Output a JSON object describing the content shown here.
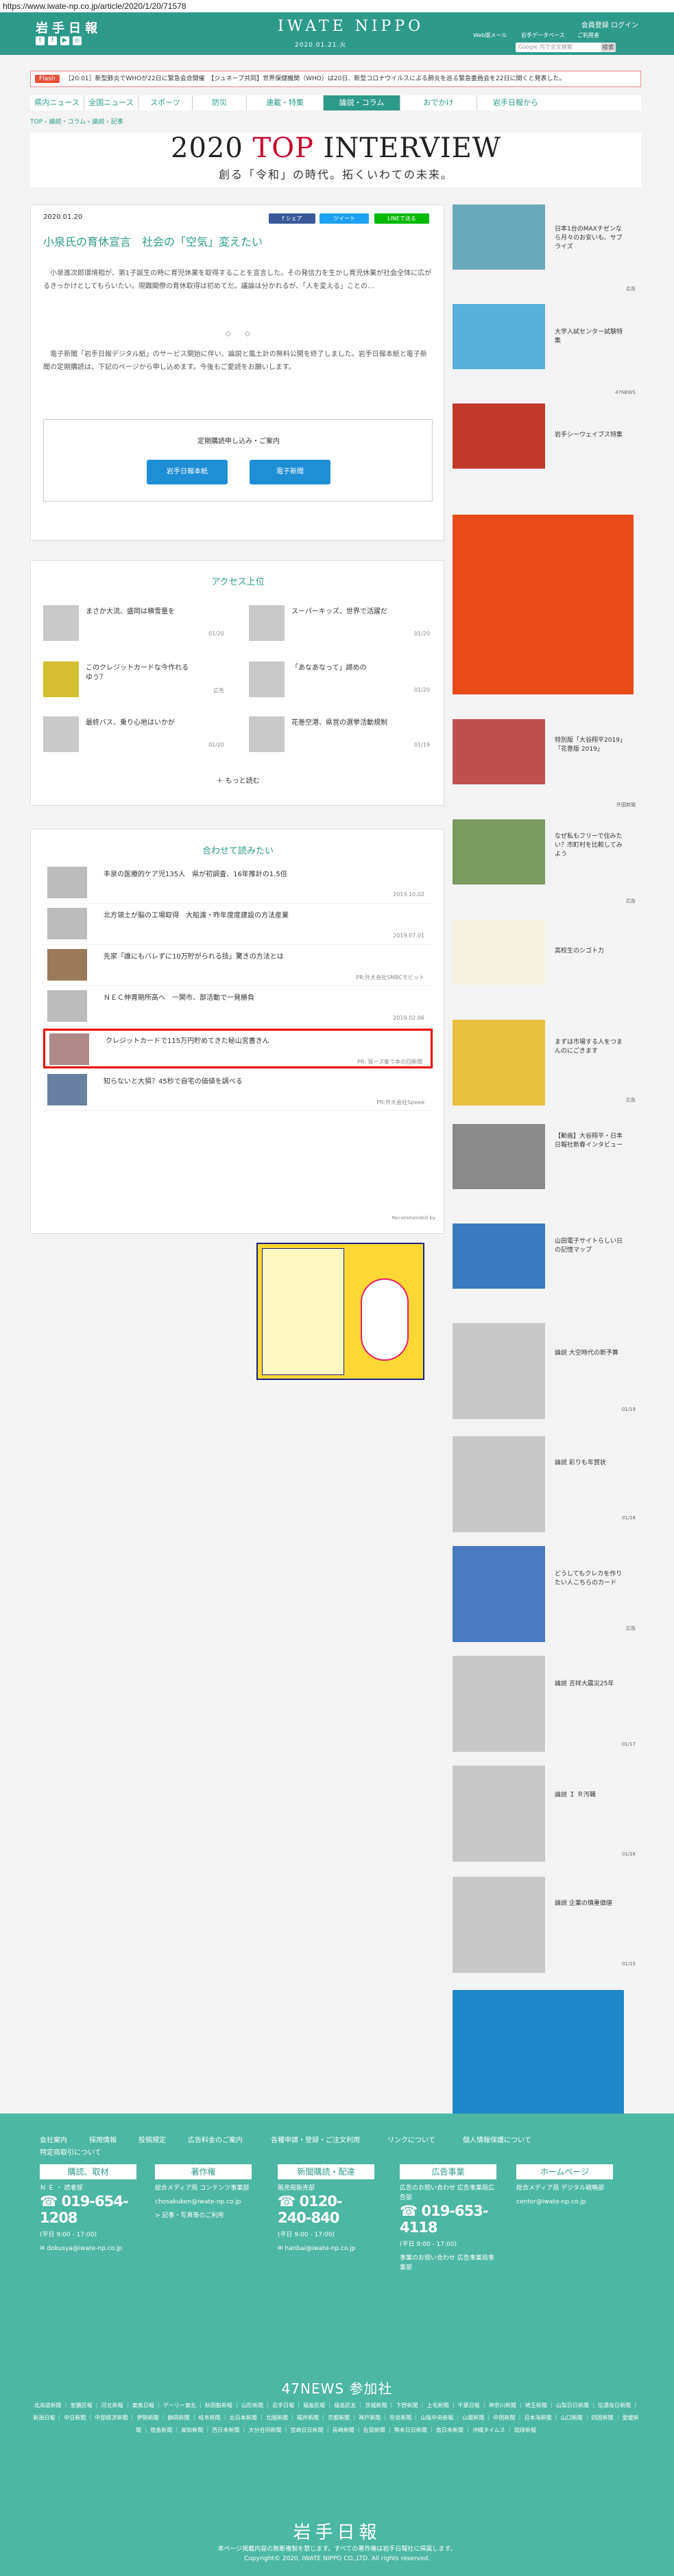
{
  "url": "https://www.iwate-np.co.jp/article/2020/1/20/71578",
  "header": {
    "logo": "岩手日報",
    "brand": "IWATE NIPPO",
    "date": "2020.01.21.火",
    "member": "会員登録  ログイン",
    "links": [
      "Web版メール",
      "岩手データベース",
      "ご利用者"
    ],
    "search_placeholder": "Google 内で全文検索",
    "search_btn": "検索"
  },
  "flash": {
    "tag": "Flash",
    "text": "［20:01］新型肺炎でWHOが22日に緊急会合開催　【ジュネーブ共同】世界保健機関（WHO）は20日、新型コロナウイルスによる肺炎を巡る緊急委員会を22日に開くと発表した。"
  },
  "nav": [
    "県内ニュース",
    "全国ニュース",
    "スポーツ",
    "防災",
    "連載・特集",
    "論説・コラム",
    "おでかけ",
    "岩手日報から"
  ],
  "nav_active": 5,
  "breadcrumb": "TOP › 論説・コラム › 論説 › 記事",
  "banner": {
    "title_a": "2020 ",
    "title_b": "TOP",
    "title_c": " INTERVIEW",
    "subtitle": "創る「令和」の時代。拓くいわての未来。"
  },
  "article": {
    "date": "2020.01.20",
    "share": [
      "f シェア",
      "ツイート",
      "LINEで送る"
    ],
    "title": "小泉氏の育休宣言　社会の「空気」変えたい",
    "body1": "　小泉進次郎環境相が、第1子誕生の時に育児休業を取得することを宣言した。その発信力を生かし育児休業が社会全体に広がるきっかけとしてもらいたい。現職閣僚の育休取得は初めてだ。議論は分かれるが、「人を変える」ことの…",
    "sep": "◇　　◇",
    "body2": "　電子新聞「岩手日報デジタル紙」のサービス開始に伴い、論説と風土計の無料公開を終了しました。岩手日報本紙と電子新聞の定期購読は、下記のページから申し込めます。今後もご愛読をお願いします。",
    "sub_title": "定期購読申し込み・ご案内",
    "btn_paper": "岩手日報本紙",
    "btn_digital": "電子新聞"
  },
  "ranking": {
    "title": "アクセス上位",
    "items": [
      {
        "t": "まさか大流、盛岡は積雪量を",
        "d": "01/20"
      },
      {
        "t": "スーパーキッズ、世界で活躍だ",
        "d": "01/20"
      },
      {
        "t": "このクレジットカードな今作れるゆう？",
        "d": "広告"
      },
      {
        "t": "「あなあなって」諦めの",
        "d": "01/20"
      },
      {
        "t": "最終バス、乗り心地はいかが",
        "d": "01/20"
      },
      {
        "t": "花巻空港、県営の選挙活動規制",
        "d": "01/19"
      }
    ],
    "more": "もっと読む"
  },
  "recommend": {
    "title": "合わせて読みたい",
    "items": [
      {
        "t": "丰泉の医療的ケア児135人　県が初調査、16年推計の1.5倍",
        "s": "2019.10.02"
      },
      {
        "t": "北方領土が脳の工場取得　大船渡・昨年度度建設の方法産業",
        "s": "2019.07.01"
      },
      {
        "t": "先家「誰にもバレずに10万貯がられる技」驚きの方法とは",
        "s": "PR:外大会社SMBCモビット"
      },
      {
        "t": "ＮＥＣ伸育期所高へ　一関市、部活動で一発勝負",
        "s": "2019.02.06"
      },
      {
        "t": "クレジットカードで115万円貯めてきた秘山宮書きん",
        "s": "PR: 買ーズ集う本の回新聞"
      },
      {
        "t": "知らないと大損？45秒で自宅の価値を調べる",
        "s": "PR:外大会社Speee"
      }
    ],
    "powered": "Recommended by"
  },
  "side": [
    {
      "t": "日本1台のMAXチゼンなら月々のお安いも、サブライズ",
      "d": "広告"
    },
    {
      "t": "大学入試センター試験特集",
      "d": "47NEWS"
    },
    {
      "t": "岩手シーウェイブス特集",
      "d": ""
    },
    {
      "t": "",
      "d": ""
    },
    {
      "t": "特別版「大谷翔平2019」「花巻版 2019」",
      "d": "外国新聞"
    },
    {
      "t": "なぜ私もフリーで住みたい？市町村を比較してみよう",
      "d": "広告"
    },
    {
      "t": "高校生のシゴト力",
      "d": ""
    },
    {
      "t": "まずは市場する人をつまんのにごきます",
      "d": "広告"
    },
    {
      "t": "【動画】大谷翔平・日本日報社新春インタビュー",
      "d": ""
    },
    {
      "t": "山田電子サイトらしい日の記憶マップ",
      "d": ""
    },
    {
      "t": "論説 大空時代の新予算",
      "d": "01/19"
    },
    {
      "t": "論説 彩りも年賀状",
      "d": "01/18"
    },
    {
      "t": "どうしてもクレカを作りたい人こちらのカード",
      "d": "広告"
    },
    {
      "t": "論説 吉祥大震災25年",
      "d": "01/17"
    },
    {
      "t": "論説 Ｉ Ｒ汚職",
      "d": "01/16"
    },
    {
      "t": "論説 企業の慎重価値",
      "d": "01/15"
    }
  ],
  "footer": {
    "links": [
      "会社案内",
      "採用情報",
      "投稿規定",
      "広告料金のご案内",
      "各種申請・登録・ご注文利用",
      "リンクについて",
      "個人情報保護について",
      "特定商取引について"
    ],
    "cols": [
      {
        "h": "購読、取材",
        "a": "Ｎ Ｅ ・ 読者部",
        "num": "019-654-1208",
        "hours": "(平日 9:00 - 17:00)",
        "mail": "dokusya@iwate-np.co.jp"
      },
      {
        "h": "著作権",
        "a": "総合メディア局 コンテンツ事業部",
        "num": "",
        "hours": "chosakuken@iwate-np.co.jp",
        "mail": "> 記事・写真等のご利用"
      },
      {
        "h": "新聞購読・配達",
        "a": "販売局販売部",
        "num": "0120-240-840",
        "hours": "(平日 9:00 - 17:00)",
        "mail": "hanbai@iwate-np.co.jp"
      },
      {
        "h": "広告事業",
        "a": "広告のお問い合わせ 広告事業局広告部",
        "num": "019-653-4118",
        "hours": "(平日 9:00 - 17:00)",
        "mail": "事業のお問い合わせ 広告事業局事業部"
      },
      {
        "h": "ホームページ",
        "a": "総合メディア局 デジタル戦略部",
        "num": "",
        "hours": "center@iwate-np.co.jp",
        "mail": ""
      }
    ],
    "n47": "47NEWS 参加社",
    "partners": "北海道新聞 ｜ 室蘭民報 ｜ 河北新報 ｜ 東奥日報 ｜ デーリー東北 ｜ 秋田魁新報 ｜ 山形新聞 ｜ 岩手日報 ｜ 福島民報 ｜ 福島民友 ｜ 茨城新聞 ｜ 下野新聞 ｜ 上毛新聞 ｜ 千葉日報 ｜ 神奈川新聞 ｜ 埼玉新聞 ｜ 山梨日日新聞 ｜ 信濃毎日新聞 ｜ 新潟日報 ｜ 中日新聞 ｜ 中部経済新聞 ｜ 伊勢新聞 ｜ 静岡新聞 ｜ 岐阜新聞 ｜ 北日本新聞 ｜ 北國新聞 ｜ 福井新聞 ｜ 京都新聞 ｜ 神戸新聞 ｜ 奈良新聞 ｜ 山陰中央新報 ｜ 山陽新聞 ｜ 中国新聞 ｜ 日本海新聞 ｜ 山口新聞 ｜ 四国新聞 ｜ 愛媛新聞 ｜ 徳島新聞 ｜ 高知新聞 ｜ 西日本新聞 ｜ 大分合同新聞 ｜ 宮崎日日新聞 ｜ 長崎新聞 ｜ 佐賀新聞 ｜ 熊本日日新聞 ｜ 南日本新聞 ｜ 沖縄タイムス ｜ 琉球新報",
    "logo": "岩手日報",
    "note": "本ページ掲載内容の無断複製を禁じます。すべての著作権は岩手日報社に帰属します。",
    "copy": "Copyright© 2020, IWATE NIPPO CO.,LTD. All rights reserved."
  },
  "colors": {
    "brand": "#2d9a8a",
    "accent": "#c6002b",
    "flash": "#e7503b",
    "button": "#1e8fd6"
  }
}
